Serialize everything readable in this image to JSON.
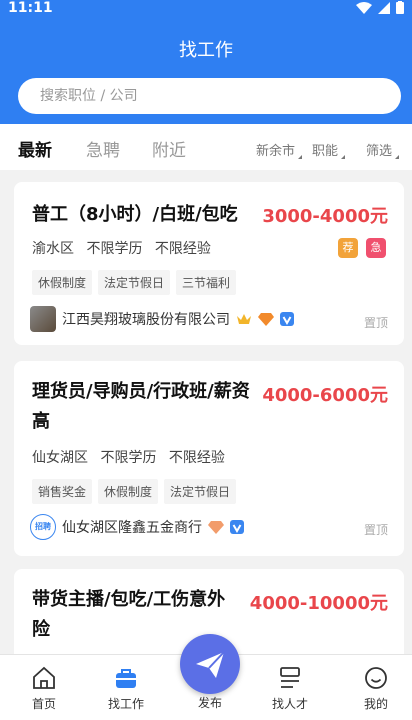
{
  "status": {
    "time": "11:11"
  },
  "header": {
    "title": "找工作"
  },
  "search": {
    "placeholder": "搜索职位 / 公司"
  },
  "tabs": [
    {
      "label": "最新"
    },
    {
      "label": "急聘"
    },
    {
      "label": "附近"
    }
  ],
  "filters": [
    {
      "label": "新余市"
    },
    {
      "label": "职能"
    },
    {
      "label": "筛选"
    }
  ],
  "jobs": [
    {
      "title": "普工（8小时）/白班/包吃",
      "salary": "3000-4000元",
      "district": "渝水区",
      "education": "不限学历",
      "experience": "不限经验",
      "tags": [
        "休假制度",
        "法定节假日",
        "三节福利"
      ],
      "company": "江西昊翔玻璃股份有限公司",
      "pin": "置顶",
      "badges": [
        "荐",
        "急"
      ]
    },
    {
      "title_line1": "理货员/导购员/行政班/薪资",
      "title_line2": "高",
      "salary": "4000-6000元",
      "district": "仙女湖区",
      "education": "不限学历",
      "experience": "不限经验",
      "tags": [
        "销售奖金",
        "休假制度",
        "法定节假日"
      ],
      "company": "仙女湖区隆鑫五金商行",
      "logo_text": "招聘",
      "pin": "置顶"
    },
    {
      "title_line1": "带货主播/包吃/工伤意外",
      "title_line2": "险",
      "salary": "4000-10000元"
    }
  ],
  "nav": [
    {
      "label": "首页"
    },
    {
      "label": "找工作"
    },
    {
      "label": "发布"
    },
    {
      "label": "找人才"
    },
    {
      "label": "我的"
    }
  ],
  "colors": {
    "primary": "#2f7ff2",
    "salary": "#e9464b",
    "publish": "#5b6fe6"
  }
}
